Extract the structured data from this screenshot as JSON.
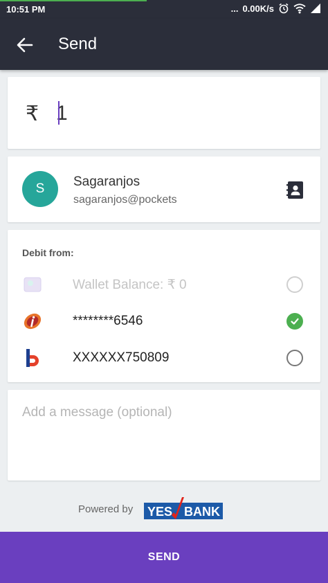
{
  "status_bar": {
    "time": "10:51 PM",
    "network_speed": "0.00K/s",
    "icons": [
      "alarm-icon",
      "wifi-icon",
      "signal-icon"
    ]
  },
  "app_bar": {
    "title": "Send",
    "back_icon": "arrow-left-icon"
  },
  "amount": {
    "currency_symbol": "₹",
    "value": "1"
  },
  "contact": {
    "avatar_initial": "S",
    "avatar_color": "#26a69a",
    "name": "Sagaranjos",
    "vpa": "sagaranjos@pockets",
    "contacts_icon": "contacts-book-icon"
  },
  "debit": {
    "label": "Debit from:",
    "options": [
      {
        "label": "Wallet Balance:  ₹ 0",
        "icon": "wallet-icon",
        "enabled": false,
        "selected": false
      },
      {
        "label": "********6546",
        "icon": "icici-bank-icon",
        "enabled": true,
        "selected": true
      },
      {
        "label": "XXXXXX750809",
        "icon": "bank-of-baroda-icon",
        "enabled": true,
        "selected": false
      }
    ]
  },
  "message": {
    "placeholder": "Add a message (optional)",
    "value": ""
  },
  "footer": {
    "powered_by": "Powered by",
    "bank_logo_text_left": "YES",
    "bank_logo_text_right": "BANK"
  },
  "send_button": {
    "label": "SEND",
    "color": "#6a3fbf"
  },
  "colors": {
    "app_bar": "#2b2e3a",
    "accent": "#6a3fbf",
    "selected_radio": "#4caf50",
    "yes_bank_blue": "#1c5aa8",
    "yes_bank_red": "#e2231a"
  }
}
